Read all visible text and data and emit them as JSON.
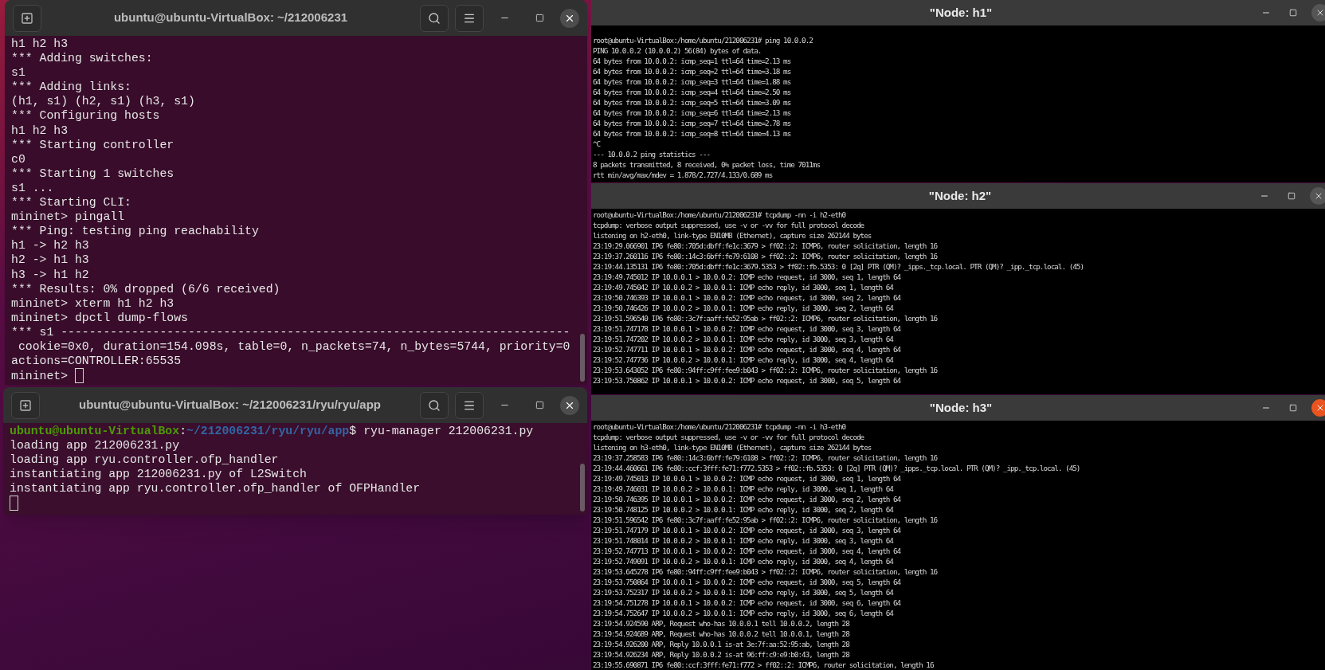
{
  "terminals": [
    {
      "title": "ubuntu@ubuntu-VirtualBox: ~/212006231",
      "lines": [
        "h1 h2 h3",
        "*** Adding switches:",
        "s1",
        "*** Adding links:",
        "(h1, s1) (h2, s1) (h3, s1)",
        "*** Configuring hosts",
        "h1 h2 h3",
        "*** Starting controller",
        "c0",
        "*** Starting 1 switches",
        "s1 ...",
        "*** Starting CLI:",
        "mininet> pingall",
        "*** Ping: testing ping reachability",
        "h1 -> h2 h3",
        "h2 -> h1 h3",
        "h3 -> h1 h2",
        "*** Results: 0% dropped (6/6 received)",
        "mininet> xterm h1 h2 h3",
        "mininet> dpctl dump-flows",
        "*** s1 ------------------------------------------------------------------------",
        " cookie=0x0, duration=154.098s, table=0, n_packets=74, n_bytes=5744, priority=0",
        "actions=CONTROLLER:65535"
      ],
      "prompt_input": "mininet>",
      "cursor": true
    },
    {
      "title": "ubuntu@ubuntu-VirtualBox: ~/212006231/ryu/ryu/app",
      "prompt": {
        "user": "ubuntu@ubuntu-VirtualBox",
        "separator": ":",
        "path": "~/212006231/ryu/ryu/app",
        "symbol": "$",
        "command": "ryu-manager 212006231.py"
      },
      "lines": [
        "loading app 212006231.py",
        "loading app ryu.controller.ofp_handler",
        "instantiating app 212006231.py of L2Switch",
        "instantiating app ryu.controller.ofp_handler of OFPHandler"
      ],
      "cursor": true
    }
  ],
  "xterms": [
    {
      "title": "\"Node: h1\"",
      "focused": false,
      "lines": [
        "root@ubuntu-VirtualBox:/home/ubuntu/212006231# ping 10.0.0.2",
        "PING 10.0.0.2 (10.0.0.2) 56(84) bytes of data.",
        "64 bytes from 10.0.0.2: icmp_seq=1 ttl=64 time=2.13 ms",
        "64 bytes from 10.0.0.2: icmp_seq=2 ttl=64 time=3.18 ms",
        "64 bytes from 10.0.0.2: icmp_seq=3 ttl=64 time=1.88 ms",
        "64 bytes from 10.0.0.2: icmp_seq=4 ttl=64 time=2.50 ms",
        "64 bytes from 10.0.0.2: icmp_seq=5 ttl=64 time=3.09 ms",
        "64 bytes from 10.0.0.2: icmp_seq=6 ttl=64 time=2.13 ms",
        "64 bytes from 10.0.0.2: icmp_seq=7 ttl=64 time=2.78 ms",
        "64 bytes from 10.0.0.2: icmp_seq=8 ttl=64 time=4.13 ms",
        "^C",
        "--- 10.0.0.2 ping statistics ---",
        "8 packets transmitted, 8 received, 0% packet loss, time 7011ms",
        "rtt min/avg/max/mdev = 1.878/2.727/4.133/0.689 ms"
      ]
    },
    {
      "title": "\"Node: h2\"",
      "focused": false,
      "lines": [
        "root@ubuntu-VirtualBox:/home/ubuntu/212006231# tcpdump -nn -i h2-eth0",
        "tcpdump: verbose output suppressed, use -v or -vv for full protocol decode",
        "listening on h2-eth0, link-type EN10MB (Ethernet), capture size 262144 bytes",
        "23:19:29.066901 IP6 fe80::705d:dbff:fe1c:3679 > ff02::2: ICMP6, router solicitation, length 16",
        "23:19:37.260116 IP6 fe80::14c3:6bff:fe79:6108 > ff02::2: ICMP6, router solicitation, length 16",
        "23:19:44.135131 IP6 fe80::705d:dbff:fe1c:3679.5353 > ff02::fb.5353: 0 [2q] PTR (QM)? _ipps._tcp.local. PTR (QM)? _ipp._tcp.local. (45)",
        "23:19:49.745012 IP 10.0.0.1 > 10.0.0.2: ICMP echo request, id 3000, seq 1, length 64",
        "23:19:49.745042 IP 10.0.0.2 > 10.0.0.1: ICMP echo reply, id 3000, seq 1, length 64",
        "23:19:50.746393 IP 10.0.0.1 > 10.0.0.2: ICMP echo request, id 3000, seq 2, length 64",
        "23:19:50.746426 IP 10.0.0.2 > 10.0.0.1: ICMP echo reply, id 3000, seq 2, length 64",
        "23:19:51.596540 IP6 fe80::3c7f:aaff:fe52:95ab > ff02::2: ICMP6, router solicitation, length 16",
        "23:19:51.747178 IP 10.0.0.1 > 10.0.0.2: ICMP echo request, id 3000, seq 3, length 64",
        "23:19:51.747202 IP 10.0.0.2 > 10.0.0.1: ICMP echo reply, id 3000, seq 3, length 64",
        "23:19:52.747711 IP 10.0.0.1 > 10.0.0.2: ICMP echo request, id 3000, seq 4, length 64",
        "23:19:52.747736 IP 10.0.0.2 > 10.0.0.1: ICMP echo reply, id 3000, seq 4, length 64",
        "23:19:53.643052 IP6 fe80::94ff:c9ff:fee9:b043 > ff02::2: ICMP6, router solicitation, length 16",
        "23:19:53.750862 IP 10.0.0.1 > 10.0.0.2: ICMP echo request, id 3000, seq 5, length 64"
      ]
    },
    {
      "title": "\"Node: h3\"",
      "focused": true,
      "lines": [
        "root@ubuntu-VirtualBox:/home/ubuntu/212006231# tcpdump -nn -i h3-eth0",
        "tcpdump: verbose output suppressed, use -v or -vv for full protocol decode",
        "listening on h3-eth0, link-type EN10MB (Ethernet), capture size 262144 bytes",
        "23:19:37.258583 IP6 fe80::14c3:6bff:fe79:6108 > ff02::2: ICMP6, router solicitation, length 16",
        "23:19:44.460661 IP6 fe80::ccf:3fff:fe71:f772.5353 > ff02::fb.5353: 0 [2q] PTR (QM)? _ipps._tcp.local. PTR (QM)? _ipp._tcp.local. (45)",
        "23:19:49.745013 IP 10.0.0.1 > 10.0.0.2: ICMP echo request, id 3000, seq 1, length 64",
        "23:19:49.746031 IP 10.0.0.2 > 10.0.0.1: ICMP echo reply, id 3000, seq 1, length 64",
        "23:19:50.746395 IP 10.0.0.1 > 10.0.0.2: ICMP echo request, id 3000, seq 2, length 64",
        "23:19:50.748125 IP 10.0.0.2 > 10.0.0.1: ICMP echo reply, id 3000, seq 2, length 64",
        "23:19:51.596542 IP6 fe80::3c7f:aaff:fe52:95ab > ff02::2: ICMP6, router solicitation, length 16",
        "23:19:51.747179 IP 10.0.0.1 > 10.0.0.2: ICMP echo request, id 3000, seq 3, length 64",
        "23:19:51.748014 IP 10.0.0.2 > 10.0.0.1: ICMP echo reply, id 3000, seq 3, length 64",
        "23:19:52.747713 IP 10.0.0.1 > 10.0.0.2: ICMP echo request, id 3000, seq 4, length 64",
        "23:19:52.749091 IP 10.0.0.2 > 10.0.0.1: ICMP echo reply, id 3000, seq 4, length 64",
        "23:19:53.645278 IP6 fe80::94ff:c9ff:fee9:b043 > ff02::2: ICMP6, router solicitation, length 16",
        "23:19:53.750864 IP 10.0.0.1 > 10.0.0.2: ICMP echo request, id 3000, seq 5, length 64",
        "23:19:53.752317 IP 10.0.0.2 > 10.0.0.1: ICMP echo reply, id 3000, seq 5, length 64",
        "23:19:54.751278 IP 10.0.0.1 > 10.0.0.2: ICMP echo request, id 3000, seq 6, length 64",
        "23:19:54.752647 IP 10.0.0.2 > 10.0.0.1: ICMP echo reply, id 3000, seq 6, length 64",
        "23:19:54.924590 ARP, Request who-has 10.0.0.1 tell 10.0.0.2, length 28",
        "23:19:54.924689 ARP, Request who-has 10.0.0.2 tell 10.0.0.1, length 28",
        "23:19:54.926200 ARP, Reply 10.0.0.1 is-at 3e:7f:aa:52:95:ab, length 28",
        "23:19:54.926234 ARP, Reply 10.0.0.2 is-at 96:ff:c9:e9:b0:43, length 28",
        "23:19:55.690871 IP6 fe80::ccf:3fff:fe71:f772 > ff02::2: ICMP6, router solicitation, length 16"
      ]
    }
  ]
}
